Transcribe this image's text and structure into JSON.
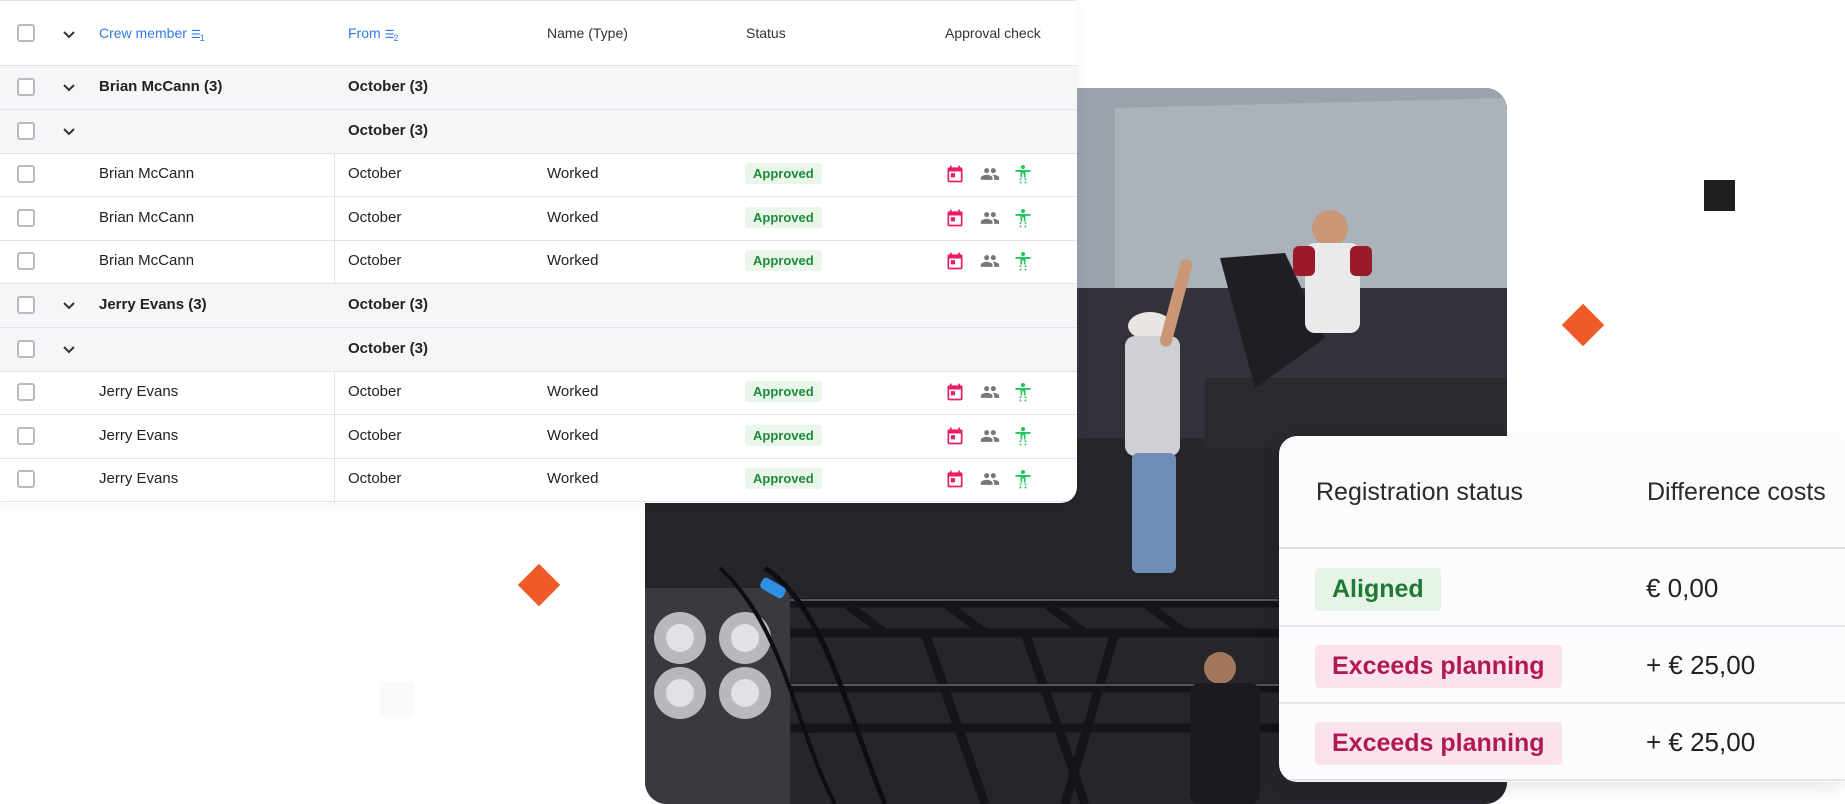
{
  "colors": {
    "accent": "#f05a28",
    "link": "#2f7de1",
    "approved_bg": "#eaf6ea",
    "approved_fg": "#1e8a3a",
    "warn_bg": "#fbe3ee",
    "warn_fg": "#b01954",
    "calendar_icon": "#e91e63",
    "person_icon": "#22c55e"
  },
  "table": {
    "headers": {
      "crew_member": "Crew member",
      "crew_member_sort": "1",
      "from": "From",
      "from_sort": "2",
      "name_type": "Name (Type)",
      "status": "Status",
      "approval_check": "Approval check"
    },
    "rows": [
      {
        "kind": "group",
        "crew": "Brian McCann (3)",
        "from": "October (3)"
      },
      {
        "kind": "group",
        "crew": "",
        "from": "October (3)"
      },
      {
        "kind": "item",
        "crew": "Brian McCann",
        "from": "October",
        "name_type": "Worked",
        "status": "Approved"
      },
      {
        "kind": "item",
        "crew": "Brian McCann",
        "from": "October",
        "name_type": "Worked",
        "status": "Approved"
      },
      {
        "kind": "item",
        "crew": "Brian McCann",
        "from": "October",
        "name_type": "Worked",
        "status": "Approved"
      },
      {
        "kind": "group",
        "crew": "Jerry Evans (3)",
        "from": "October (3)"
      },
      {
        "kind": "group",
        "crew": "",
        "from": "October (3)"
      },
      {
        "kind": "item",
        "crew": "Jerry Evans",
        "from": "October",
        "name_type": "Worked",
        "status": "Approved"
      },
      {
        "kind": "item",
        "crew": "Jerry Evans",
        "from": "October",
        "name_type": "Worked",
        "status": "Approved"
      },
      {
        "kind": "item",
        "crew": "Jerry Evans",
        "from": "October",
        "name_type": "Worked",
        "status": "Approved"
      }
    ],
    "approval_icons": [
      "calendar-icon",
      "people-icon",
      "accessibility-icon"
    ]
  },
  "registration": {
    "headers": {
      "status": "Registration status",
      "cost": "Difference costs"
    },
    "rows": [
      {
        "status": "Aligned",
        "tone": "ok",
        "cost": "€ 0,00"
      },
      {
        "status": "Exceeds planning",
        "tone": "warn",
        "cost": "+ € 25,00"
      },
      {
        "status": "Exceeds planning",
        "tone": "warn",
        "cost": "+ € 25,00"
      }
    ]
  }
}
